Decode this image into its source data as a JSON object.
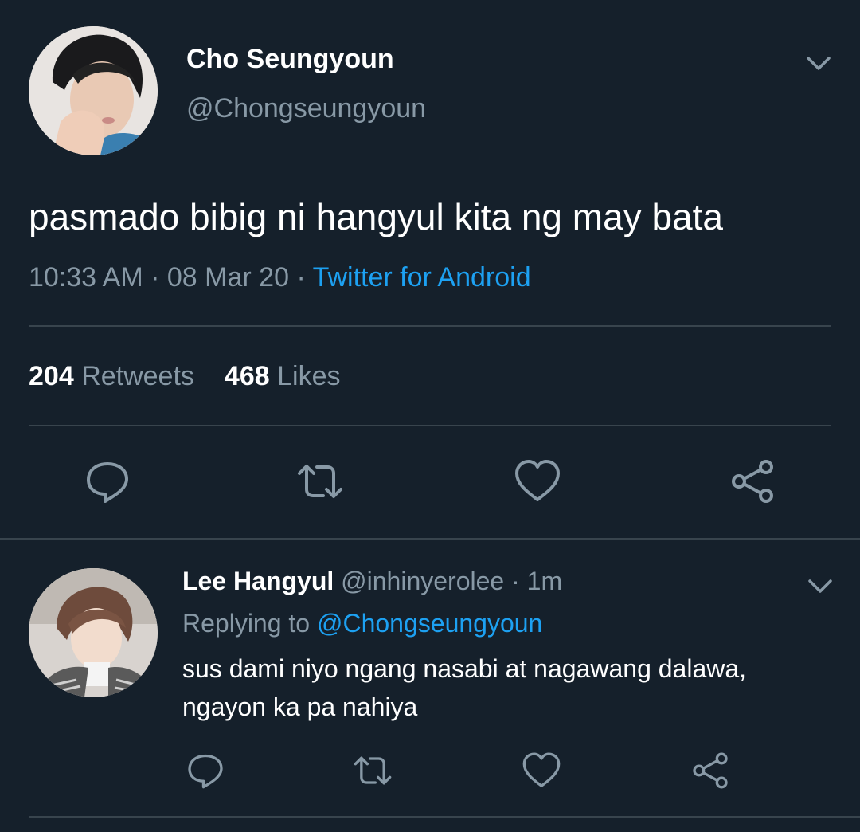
{
  "colors": {
    "background": "#15202b",
    "muted_text": "#8899a6",
    "link": "#1da1f2",
    "divider": "#38444d"
  },
  "main_tweet": {
    "display_name": "Cho Seungyoun",
    "handle": "@Chongseungyoun",
    "text": "pasmado bibig ni hangyul kita ng may bata",
    "time": "10:33 AM",
    "separator": "·",
    "date": "08 Mar 20",
    "source": "Twitter for Android",
    "retweets_count": "204",
    "retweets_label": "Retweets",
    "likes_count": "468",
    "likes_label": "Likes",
    "actions": [
      "reply-icon",
      "retweet-icon",
      "like-icon",
      "share-icon"
    ]
  },
  "reply_tweet": {
    "display_name": "Lee Hangyul",
    "handle": "@inhinyerolee",
    "separator": "·",
    "age": "1m",
    "replying_prefix": "Replying to",
    "replying_to": "@Chongseungyoun",
    "text_line1": "sus dami niyo ngang nasabi at nagawang dalawa,",
    "text_line2": "ngayon ka pa nahiya",
    "actions": [
      "reply-icon",
      "retweet-icon",
      "like-icon",
      "share-icon"
    ]
  }
}
